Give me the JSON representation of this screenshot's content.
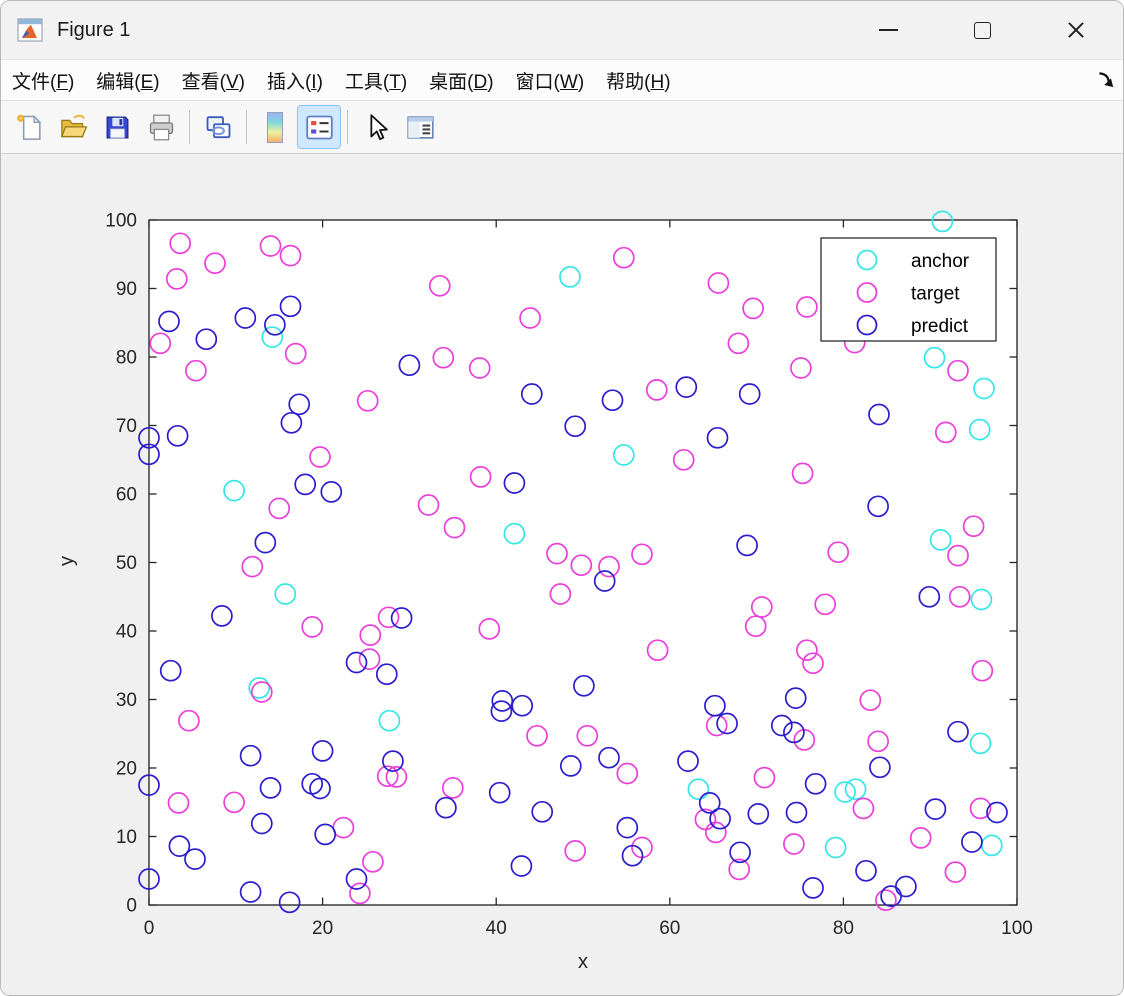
{
  "window": {
    "title": "Figure 1",
    "controls": [
      "minimize",
      "maximize",
      "close"
    ]
  },
  "menu": {
    "items": [
      {
        "pre": "文件(",
        "key": "F",
        "post": ")"
      },
      {
        "pre": "编辑(",
        "key": "E",
        "post": ")"
      },
      {
        "pre": "查看(",
        "key": "V",
        "post": ")"
      },
      {
        "pre": "插入(",
        "key": "I",
        "post": ")"
      },
      {
        "pre": "工具(",
        "key": "T",
        "post": ")"
      },
      {
        "pre": "桌面(",
        "key": "D",
        "post": ")"
      },
      {
        "pre": "窗口(",
        "key": "W",
        "post": ")"
      },
      {
        "pre": "帮助(",
        "key": "H",
        "post": ")"
      }
    ],
    "dock_icon": "dock-figure-arrow"
  },
  "toolbar": {
    "icons": [
      "new-figure",
      "open-file",
      "save-figure",
      "print-figure",
      "link-plot",
      "insert-colorbar",
      "insert-legend",
      "edit-plot",
      "property-inspector"
    ],
    "active": "insert-legend"
  },
  "chart_data": {
    "type": "scatter",
    "title": "",
    "xlabel": "x",
    "ylabel": "y",
    "xlim": [
      0,
      100
    ],
    "ylim": [
      0,
      100
    ],
    "x_ticks": [
      0,
      20,
      40,
      60,
      80,
      100
    ],
    "y_ticks": [
      0,
      10,
      20,
      30,
      40,
      50,
      60,
      70,
      80,
      90,
      100
    ],
    "grid": false,
    "legend_position": "top-right",
    "marker": "open-circle",
    "series": [
      {
        "name": "anchor",
        "color": "#35e6e6",
        "points": [
          [
            14.2,
            82.9
          ],
          [
            48.5,
            91.7
          ],
          [
            91.4,
            99.8
          ],
          [
            90.5,
            79.9
          ],
          [
            96.2,
            75.4
          ],
          [
            9.8,
            60.5
          ],
          [
            54.7,
            65.7
          ],
          [
            42.1,
            54.2
          ],
          [
            95.7,
            69.4
          ],
          [
            91.2,
            53.3
          ],
          [
            15.7,
            45.4
          ],
          [
            12.7,
            31.7
          ],
          [
            27.7,
            26.9
          ],
          [
            95.9,
            44.6
          ],
          [
            95.8,
            23.6
          ],
          [
            63.3,
            16.9
          ],
          [
            80.2,
            16.5
          ],
          [
            81.4,
            16.9
          ],
          [
            79.1,
            8.4
          ],
          [
            97.1,
            8.7
          ]
        ]
      },
      {
        "name": "target",
        "color": "#ea3fd9",
        "points": [
          [
            3.6,
            96.6
          ],
          [
            14.0,
            96.2
          ],
          [
            16.3,
            94.8
          ],
          [
            7.6,
            93.7
          ],
          [
            3.2,
            91.4
          ],
          [
            1.3,
            82.0
          ],
          [
            16.9,
            80.5
          ],
          [
            5.4,
            78.0
          ],
          [
            33.5,
            90.4
          ],
          [
            54.7,
            94.5
          ],
          [
            43.9,
            85.7
          ],
          [
            33.9,
            79.9
          ],
          [
            38.1,
            78.4
          ],
          [
            58.5,
            75.2
          ],
          [
            65.6,
            90.8
          ],
          [
            69.6,
            87.1
          ],
          [
            75.8,
            87.3
          ],
          [
            67.9,
            82.0
          ],
          [
            81.3,
            82.1
          ],
          [
            93.2,
            78.0
          ],
          [
            75.1,
            78.4
          ],
          [
            25.2,
            73.6
          ],
          [
            19.7,
            65.4
          ],
          [
            15.0,
            57.9
          ],
          [
            61.6,
            65.0
          ],
          [
            38.2,
            62.5
          ],
          [
            32.2,
            58.4
          ],
          [
            35.2,
            55.1
          ],
          [
            47.0,
            51.3
          ],
          [
            49.8,
            49.6
          ],
          [
            53.0,
            49.4
          ],
          [
            56.8,
            51.2
          ],
          [
            91.8,
            69.0
          ],
          [
            75.3,
            63.0
          ],
          [
            95.0,
            55.3
          ],
          [
            79.4,
            51.5
          ],
          [
            11.9,
            49.4
          ],
          [
            18.8,
            40.6
          ],
          [
            27.6,
            42.0
          ],
          [
            25.5,
            39.4
          ],
          [
            25.4,
            35.9
          ],
          [
            13.0,
            31.1
          ],
          [
            4.6,
            26.9
          ],
          [
            47.4,
            45.4
          ],
          [
            39.2,
            40.3
          ],
          [
            58.6,
            37.2
          ],
          [
            93.2,
            51.0
          ],
          [
            93.4,
            45.0
          ],
          [
            70.6,
            43.5
          ],
          [
            69.9,
            40.7
          ],
          [
            77.9,
            43.9
          ],
          [
            75.8,
            37.2
          ],
          [
            76.5,
            35.3
          ],
          [
            96.0,
            34.2
          ],
          [
            83.1,
            29.9
          ],
          [
            27.5,
            18.8
          ],
          [
            28.5,
            18.7
          ],
          [
            3.4,
            14.9
          ],
          [
            9.8,
            15.0
          ],
          [
            22.4,
            11.3
          ],
          [
            25.8,
            6.3
          ],
          [
            24.3,
            1.7
          ],
          [
            44.7,
            24.7
          ],
          [
            50.5,
            24.7
          ],
          [
            55.1,
            19.2
          ],
          [
            35.0,
            17.1
          ],
          [
            49.1,
            7.9
          ],
          [
            56.8,
            8.4
          ],
          [
            65.4,
            26.2
          ],
          [
            75.5,
            24.1
          ],
          [
            84.0,
            23.9
          ],
          [
            70.9,
            18.6
          ],
          [
            64.1,
            12.5
          ],
          [
            65.3,
            10.6
          ],
          [
            82.3,
            14.1
          ],
          [
            95.8,
            14.1
          ],
          [
            88.9,
            9.8
          ],
          [
            74.3,
            8.9
          ],
          [
            68.0,
            5.2
          ],
          [
            92.9,
            4.8
          ],
          [
            84.9,
            0.7
          ]
        ]
      },
      {
        "name": "predict",
        "color": "#2a1dcd",
        "points": [
          [
            16.3,
            87.4
          ],
          [
            11.1,
            85.7
          ],
          [
            2.3,
            85.2
          ],
          [
            14.5,
            84.7
          ],
          [
            6.6,
            82.6
          ],
          [
            30.0,
            78.8
          ],
          [
            44.1,
            74.6
          ],
          [
            61.9,
            75.6
          ],
          [
            69.2,
            74.6
          ],
          [
            17.3,
            73.1
          ],
          [
            16.4,
            70.4
          ],
          [
            3.3,
            68.5
          ],
          [
            0.0,
            68.2
          ],
          [
            0.0,
            65.8
          ],
          [
            18.0,
            61.4
          ],
          [
            21.0,
            60.3
          ],
          [
            13.4,
            52.9
          ],
          [
            53.4,
            73.7
          ],
          [
            49.1,
            69.9
          ],
          [
            65.5,
            68.2
          ],
          [
            42.1,
            61.6
          ],
          [
            84.1,
            71.6
          ],
          [
            84.0,
            58.2
          ],
          [
            68.9,
            52.5
          ],
          [
            8.4,
            42.2
          ],
          [
            29.1,
            41.9
          ],
          [
            23.9,
            35.4
          ],
          [
            27.4,
            33.7
          ],
          [
            2.5,
            34.2
          ],
          [
            52.5,
            47.3
          ],
          [
            50.1,
            32.0
          ],
          [
            40.7,
            29.8
          ],
          [
            40.6,
            28.3
          ],
          [
            43.0,
            29.1
          ],
          [
            89.9,
            45.0
          ],
          [
            65.2,
            29.1
          ],
          [
            74.5,
            30.2
          ],
          [
            66.6,
            26.5
          ],
          [
            72.9,
            26.2
          ],
          [
            74.3,
            25.2
          ],
          [
            93.2,
            25.3
          ],
          [
            11.7,
            21.8
          ],
          [
            20.0,
            22.5
          ],
          [
            28.1,
            21.0
          ],
          [
            0.0,
            17.5
          ],
          [
            14.0,
            17.1
          ],
          [
            18.8,
            17.7
          ],
          [
            19.7,
            17.0
          ],
          [
            13.0,
            11.9
          ],
          [
            20.3,
            10.3
          ],
          [
            3.5,
            8.6
          ],
          [
            5.3,
            6.7
          ],
          [
            0.0,
            3.8
          ],
          [
            23.9,
            3.8
          ],
          [
            11.7,
            1.9
          ],
          [
            16.2,
            0.4
          ],
          [
            53.0,
            21.5
          ],
          [
            48.6,
            20.3
          ],
          [
            62.1,
            21.0
          ],
          [
            40.4,
            16.4
          ],
          [
            34.2,
            14.2
          ],
          [
            45.3,
            13.6
          ],
          [
            64.6,
            14.9
          ],
          [
            65.8,
            12.6
          ],
          [
            55.1,
            11.3
          ],
          [
            55.7,
            7.2
          ],
          [
            42.9,
            5.7
          ],
          [
            84.2,
            20.1
          ],
          [
            76.8,
            17.7
          ],
          [
            70.2,
            13.3
          ],
          [
            74.6,
            13.5
          ],
          [
            90.6,
            14.0
          ],
          [
            97.7,
            13.5
          ],
          [
            94.8,
            9.2
          ],
          [
            68.1,
            7.7
          ],
          [
            82.6,
            5.0
          ],
          [
            76.5,
            2.5
          ],
          [
            87.2,
            2.7
          ],
          [
            85.5,
            1.3
          ]
        ]
      }
    ]
  }
}
